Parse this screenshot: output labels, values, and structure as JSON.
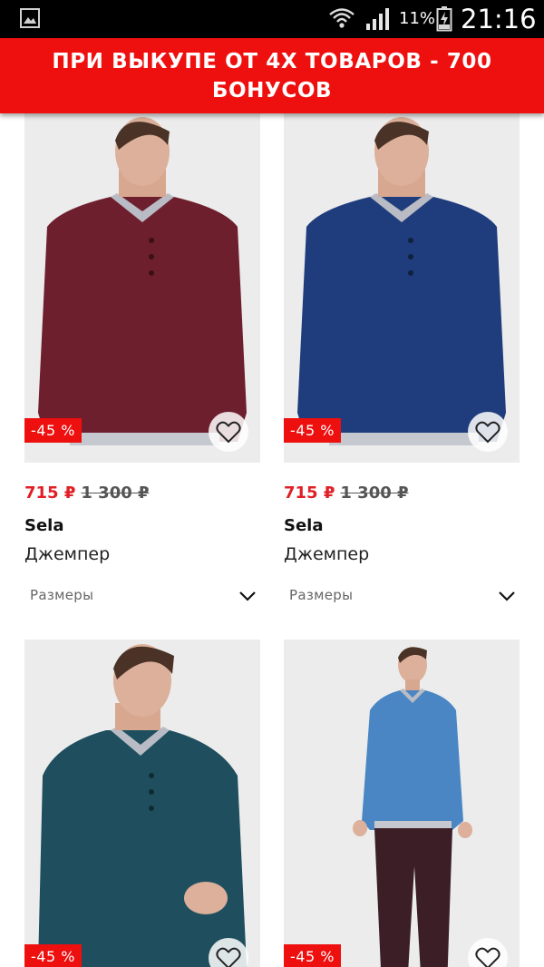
{
  "status_bar": {
    "battery_percent": "11%",
    "time": "21:16",
    "icons": [
      "gallery-icon",
      "wifi-icon",
      "signal-icon",
      "battery-charging-icon"
    ]
  },
  "promo": {
    "text": "ПРИ ВЫКУПЕ ОТ 4Х ТОВАРОВ - 700 БОНУСОВ"
  },
  "colors": {
    "accent_red": "#ee0f0f",
    "price_red": "#e01f26"
  },
  "products": [
    {
      "discount": "-45 %",
      "price": "715 ₽",
      "old_price": "1 300 ₽",
      "brand": "Sela",
      "name": "Джемпер",
      "sizes_label": "Размеры",
      "garment_color": "#6e1f2e"
    },
    {
      "discount": "-45 %",
      "price": "715 ₽",
      "old_price": "1 300 ₽",
      "brand": "Sela",
      "name": "Джемпер",
      "sizes_label": "Размеры",
      "garment_color": "#1f3d7c"
    },
    {
      "discount": "-45 %",
      "garment_color": "#1f4f5e"
    },
    {
      "discount": "-45 %",
      "garment_color": "#4a86c4"
    }
  ]
}
